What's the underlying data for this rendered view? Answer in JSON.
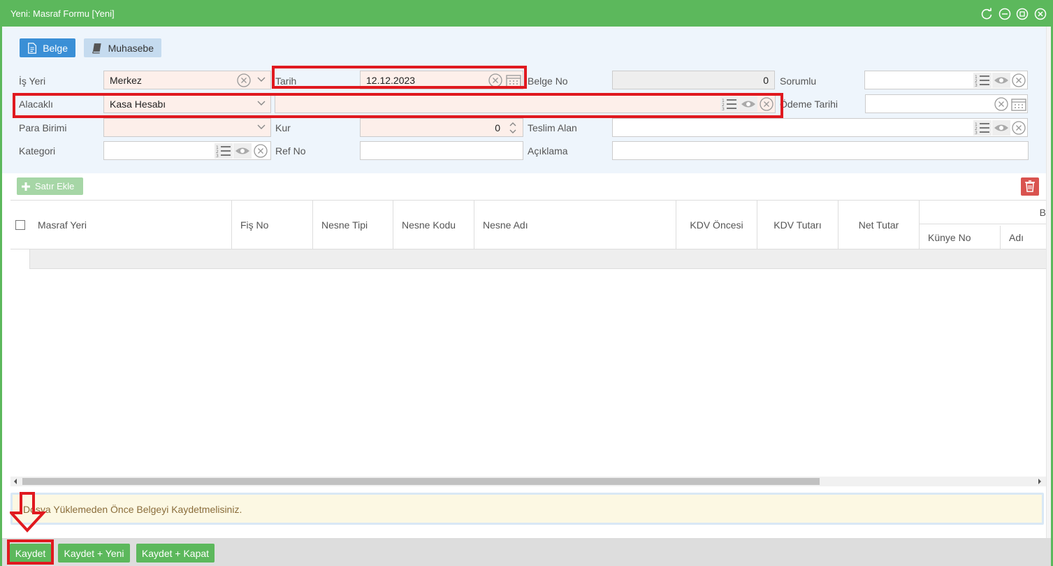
{
  "window": {
    "title": "Yeni: Masraf Formu [Yeni]"
  },
  "tabs": [
    {
      "label": "Belge"
    },
    {
      "label": "Muhasebe"
    }
  ],
  "form": {
    "is_yeri": {
      "label": "İş Yeri",
      "value": "Merkez"
    },
    "tarih": {
      "label": "Tarih",
      "value": "12.12.2023"
    },
    "belge_no": {
      "label": "Belge No",
      "value": "0"
    },
    "sorumlu": {
      "label": "Sorumlu",
      "value": ""
    },
    "alacakli": {
      "label": "Alacaklı",
      "value": "Kasa Hesabı",
      "detail": ""
    },
    "odeme_tarihi": {
      "label": "Ödeme Tarihi",
      "value": ""
    },
    "para_birimi": {
      "label": "Para Birimi",
      "value": ""
    },
    "kur": {
      "label": "Kur",
      "value": "0"
    },
    "teslim_alan": {
      "label": "Teslim Alan",
      "value": ""
    },
    "kategori": {
      "label": "Kategori",
      "value": ""
    },
    "ref_no": {
      "label": "Ref No",
      "value": ""
    },
    "aciklama": {
      "label": "Açıklama",
      "value": ""
    }
  },
  "toolbar": {
    "satir_ekle": "Satır Ekle"
  },
  "grid": {
    "columns": [
      "Masraf Yeri",
      "Fiş No",
      "Nesne Tipi",
      "Nesne Kodu",
      "Nesne Adı",
      "KDV Öncesi",
      "KDV Tutarı",
      "Net Tutar"
    ],
    "group_header_partial": "B",
    "sub_columns": [
      "Künye No",
      "Adı"
    ]
  },
  "notice": {
    "text": "Dosya Yüklemeden Önce Belgeyi Kaydetmelisiniz."
  },
  "footer": {
    "kaydet": "Kaydet",
    "kaydet_yeni": "Kaydet + Yeni",
    "kaydet_kapat": "Kaydet + Kapat"
  },
  "colors": {
    "brand": "#5cb85c",
    "highlight": "#e0191f",
    "tab_active": "#3a8fd6",
    "required_bg": "#fdefea"
  }
}
